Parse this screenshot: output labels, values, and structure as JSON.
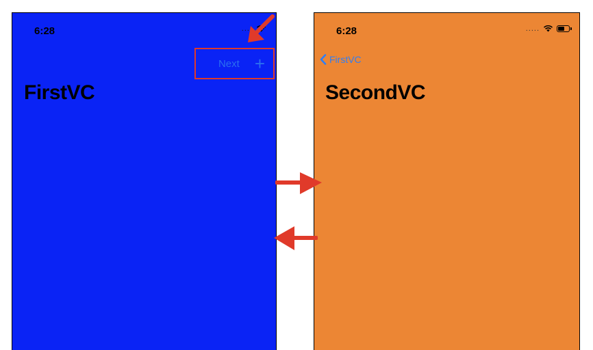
{
  "colors": {
    "first_background": "#0a23f5",
    "second_background": "#ec8634",
    "nav_tint_first": "#2b6ff0",
    "nav_tint_second": "#2f7ef5",
    "annotation_red": "#e03a2a"
  },
  "first_screen": {
    "status_time": "6:28",
    "nav_next_label": "Next",
    "nav_add_symbol": "+",
    "title": "FirstVC"
  },
  "second_screen": {
    "status_time": "6:28",
    "back_label": "FirstVC",
    "title": "SecondVC",
    "status_dots": "....."
  },
  "icons": {
    "status": [
      "cellular-dots-icon",
      "wifi-icon",
      "battery-icon"
    ],
    "back": "chevron-left-icon",
    "annotations": [
      "arrow-down-left-icon",
      "arrow-right-icon",
      "arrow-left-icon"
    ]
  }
}
